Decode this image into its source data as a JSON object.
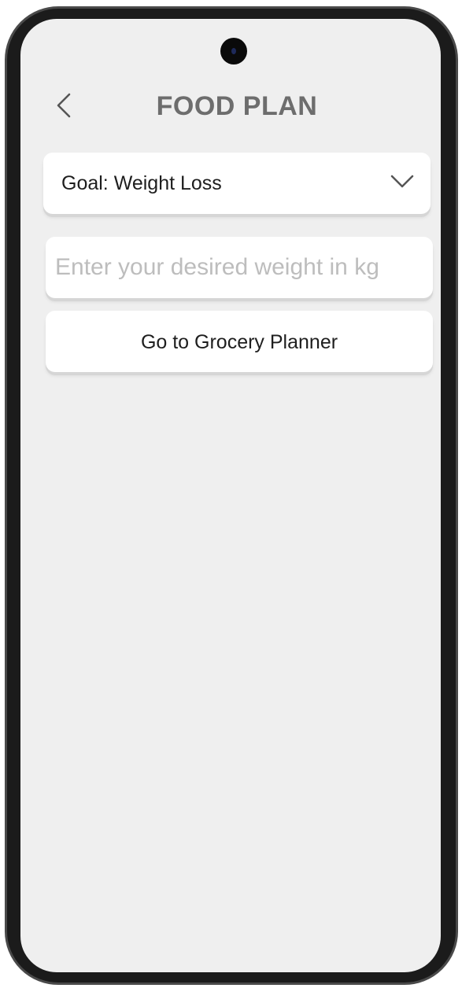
{
  "header": {
    "title": "FOOD PLAN",
    "back_icon": "chevron-left-icon"
  },
  "goal_select": {
    "selected_value": "Goal: Weight Loss",
    "icon": "chevron-down-icon"
  },
  "weight_input": {
    "value": "",
    "placeholder": "Enter your desired weight in kg"
  },
  "grocery_button": {
    "label": "Go to Grocery Planner"
  },
  "colors": {
    "screen_background": "#efefef",
    "card_background": "#ffffff",
    "title_text": "#6d6d6d",
    "placeholder_text": "#bdbdbd",
    "phone_frame": "#1b1b1b"
  }
}
